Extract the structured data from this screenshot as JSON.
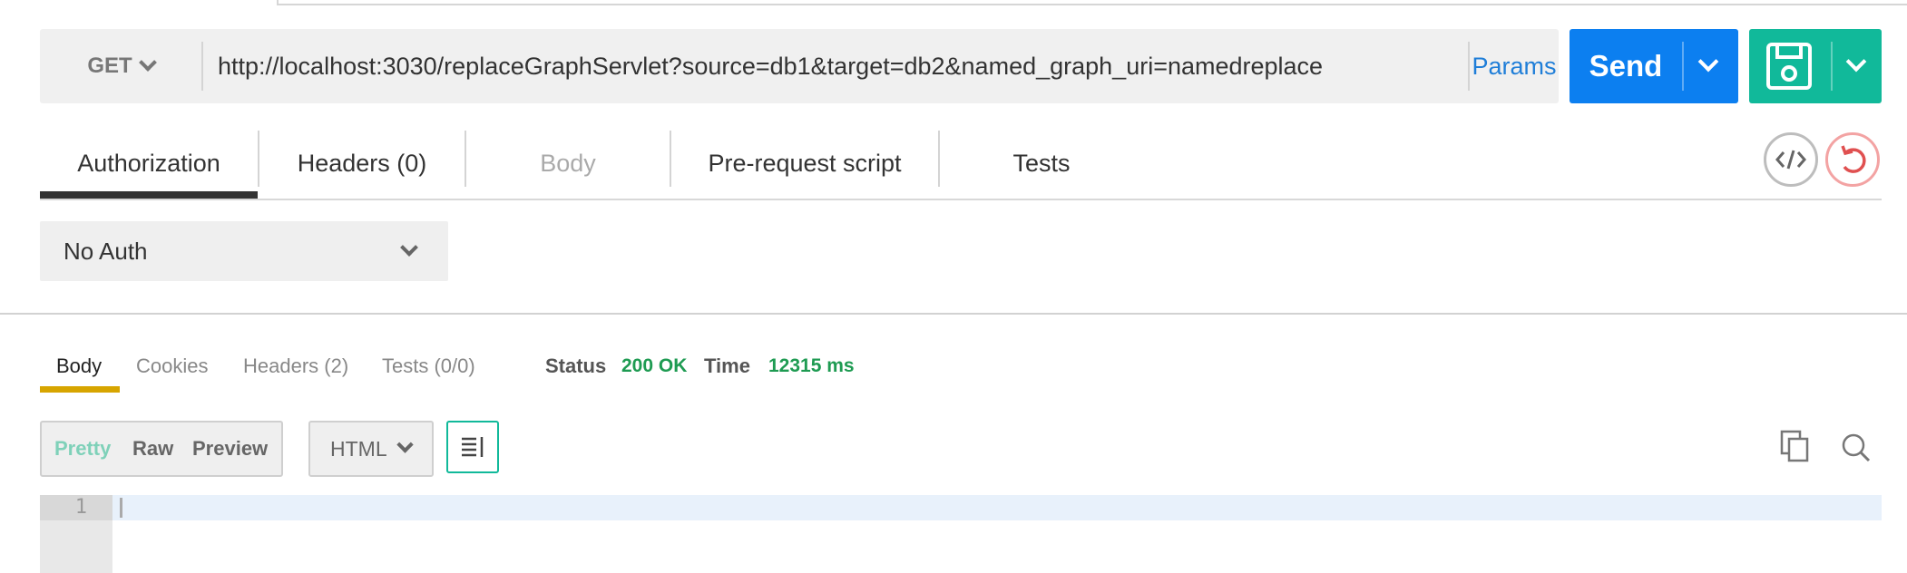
{
  "request": {
    "method": "GET",
    "url": "http://localhost:3030/replaceGraphServlet?source=db1&target=db2&named_graph_uri=namedreplace",
    "params_label": "Params",
    "send_label": "Send"
  },
  "request_tabs": [
    {
      "label": "Authorization",
      "active": true
    },
    {
      "label": "Headers (0)"
    },
    {
      "label": "Body",
      "disabled": true
    },
    {
      "label": "Pre-request script"
    },
    {
      "label": "Tests"
    }
  ],
  "auth": {
    "selected": "No Auth"
  },
  "response": {
    "tabs": [
      "Body",
      "Cookies",
      "Headers (2)",
      "Tests (0/0)"
    ],
    "active_tab": "Body",
    "status_label": "Status",
    "status_value": "200 OK",
    "time_label": "Time",
    "time_value": "12315 ms"
  },
  "format": {
    "options": [
      "Pretty",
      "Raw",
      "Preview"
    ],
    "active": "Pretty",
    "language": "HTML"
  },
  "editor": {
    "line_numbers": [
      "1"
    ]
  },
  "icons": {
    "method_dropdown": "chevron-down-icon",
    "send_dropdown": "chevron-down-icon",
    "save": "floppy-disk-icon",
    "code": "code-icon",
    "reset": "reset-icon",
    "wrap": "wrap-lines-icon",
    "copy": "copy-icon",
    "search": "search-icon"
  },
  "colors": {
    "send": "#0c7ff0",
    "save": "#11b99a",
    "status_ok": "#1e9b52",
    "body_tab_accent": "#d7a500",
    "params_link": "#1f7ed8"
  }
}
